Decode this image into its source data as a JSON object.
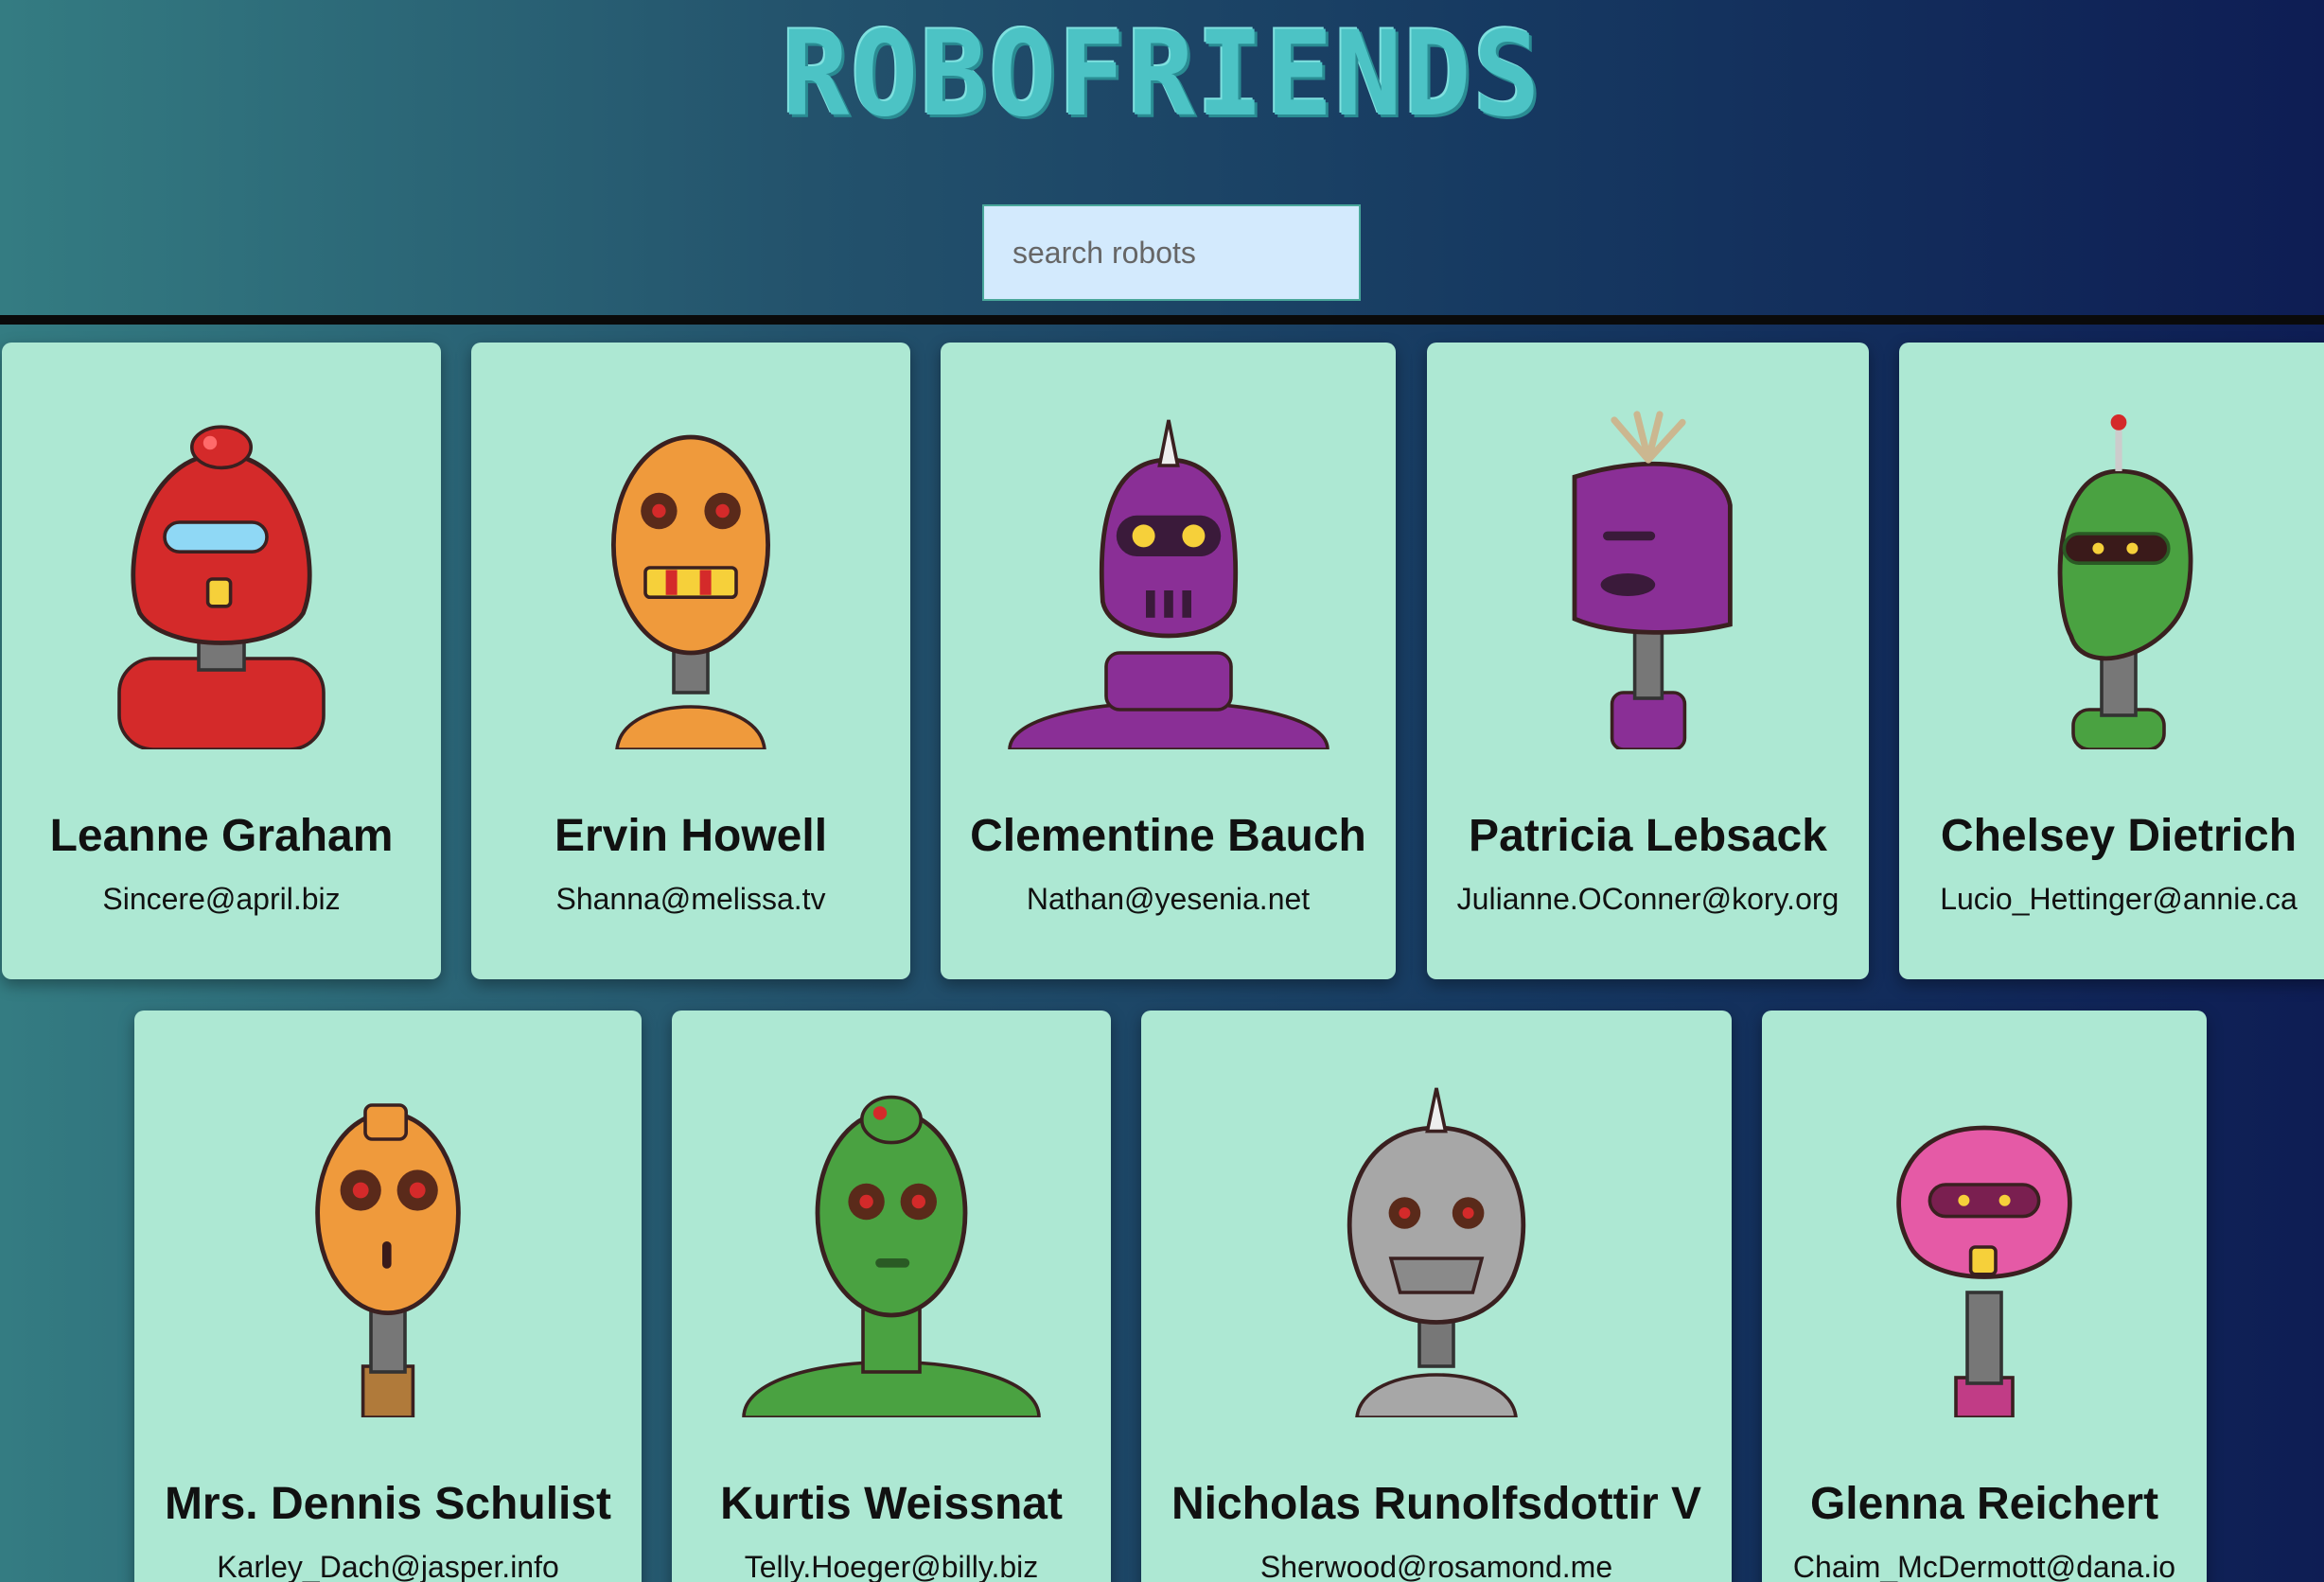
{
  "app": {
    "title": "ROBOFRIENDS"
  },
  "search": {
    "placeholder": "search robots",
    "value": ""
  },
  "robots": [
    {
      "name": "Leanne Graham",
      "email": "Sincere@april.biz",
      "color": "#d42a2a"
    },
    {
      "name": "Ervin Howell",
      "email": "Shanna@melissa.tv",
      "color": "#ef9a3c"
    },
    {
      "name": "Clementine Bauch",
      "email": "Nathan@yesenia.net",
      "color": "#8a2f96"
    },
    {
      "name": "Patricia Lebsack",
      "email": "Julianne.OConner@kory.org",
      "color": "#8a2f96"
    },
    {
      "name": "Chelsey Dietrich",
      "email": "Lucio_Hettinger@annie.ca",
      "color": "#4aa241"
    },
    {
      "name": "Mrs. Dennis Schulist",
      "email": "Karley_Dach@jasper.info",
      "color": "#ef9a3c"
    },
    {
      "name": "Kurtis Weissnat",
      "email": "Telly.Hoeger@billy.biz",
      "color": "#4aa241"
    },
    {
      "name": "Nicholas Runolfsdottir V",
      "email": "Sherwood@rosamond.me",
      "color": "#a7a7a7"
    },
    {
      "name": "Glenna Reichert",
      "email": "Chaim_McDermott@dana.io",
      "color": "#e55aa6"
    }
  ]
}
